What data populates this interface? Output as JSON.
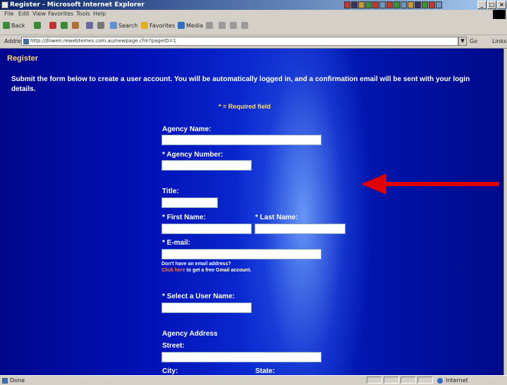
{
  "window": {
    "title": "Register - Microsoft Internet Explorer",
    "min_label": "_",
    "max_label": "□",
    "close_label": "×"
  },
  "menu": [
    "File",
    "Edit",
    "View",
    "Favorites",
    "Tools",
    "Help"
  ],
  "toolbar": {
    "back": "Back",
    "search": "Search",
    "favorites": "Favorites",
    "media": "Media"
  },
  "address": {
    "label": "Address",
    "url": "http://jfowen.rewebtemes.com.au/newpage.cfm?pageID=1",
    "go": "Go",
    "links": "Links"
  },
  "page": {
    "heading": "Register",
    "intro": "Submit the form below to create a user account. You will be automatically logged in, and a confirmation email will be sent with your login details.",
    "required_note": "* = Required field",
    "fields": {
      "agency_name": "Agency Name:",
      "agency_number": "* Agency Number:",
      "title": "Title:",
      "first_name": "* First Name:",
      "last_name": "* Last Name:",
      "email": "* E-mail:",
      "username": "* Select a User Name:",
      "street": "Street:",
      "city": "City:",
      "state": "State:"
    },
    "no_email": "Don't have an email address?",
    "gmail_link": "Click here",
    "gmail_rest": " to get a free Gmail account.",
    "agency_address": "Agency Address"
  },
  "status": {
    "text": "Done",
    "zone": "Internet"
  },
  "colors": {
    "arrow": "#e00000",
    "heading": "#ffd966",
    "link": "#ff7a4a"
  }
}
